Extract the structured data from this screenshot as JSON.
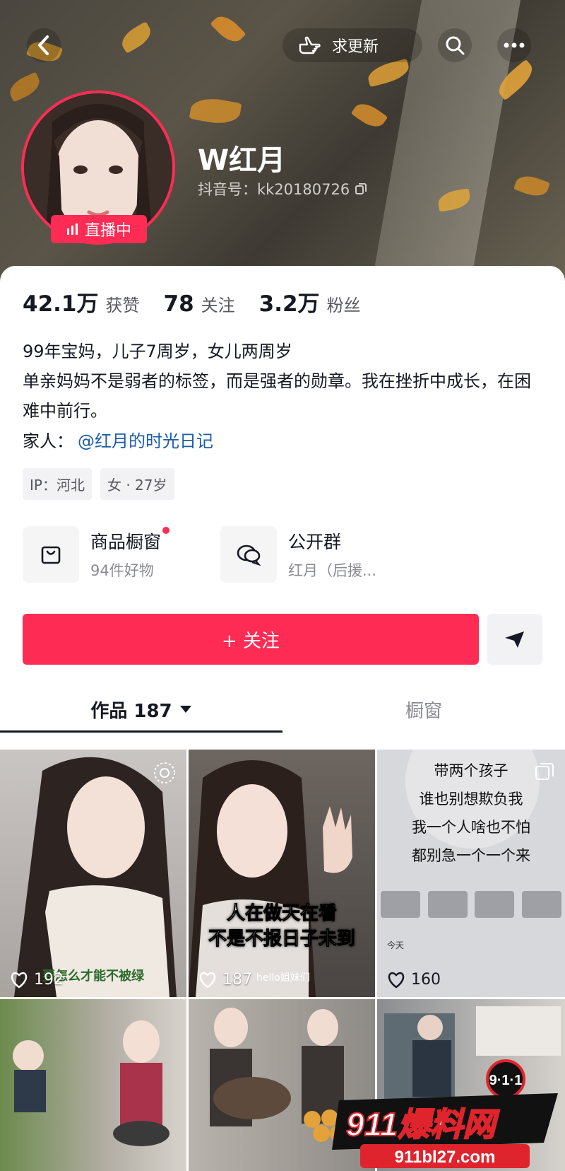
{
  "header": {
    "request_update_label": "求更新",
    "username": "W红月",
    "douyin_id": "抖音号：kk20180726",
    "live_label": "直播中"
  },
  "stats": [
    {
      "value": "42.1万",
      "label": "获赞"
    },
    {
      "value": "78",
      "label": "关注"
    },
    {
      "value": "3.2万",
      "label": "粉丝"
    }
  ],
  "bio": {
    "line1": "99年宝妈，儿子7周岁，女儿两周岁",
    "line2": "单亲妈妈不是弱者的标签，而是强者的勋章。我在挫折中成长，在困难中前行。",
    "family_label": "家人：",
    "family_link": "@红月的时光日记"
  },
  "tags": [
    "IP：河北",
    "女 · 27岁"
  ],
  "shortcuts": {
    "shop": {
      "title": "商品橱窗",
      "subtitle": "94件好物"
    },
    "group": {
      "title": "公开群",
      "subtitle": "红月（后援..."
    }
  },
  "actions": {
    "follow_label": "+ 关注"
  },
  "tabs": {
    "works": "作品 187",
    "showcase": "橱窗"
  },
  "posts": [
    {
      "likes": "192",
      "caption": "要怎么才能不被绿"
    },
    {
      "likes": "187",
      "caption": "人在做天在看\n不是不报日子未到",
      "subtext": "hello姐妹们"
    },
    {
      "likes": "160",
      "note_lines": [
        "带两个孩子",
        "谁也别想欺负我",
        "我一个人啥也不怕",
        "都别急一个一个来"
      ],
      "note_footer": "今天"
    }
  ],
  "watermark": {
    "badge": "9·1·1",
    "title": "911爆料网",
    "domain": "911bl27.com"
  },
  "colors": {
    "accent": "#fe2c55",
    "link": "#1b5ca8"
  }
}
